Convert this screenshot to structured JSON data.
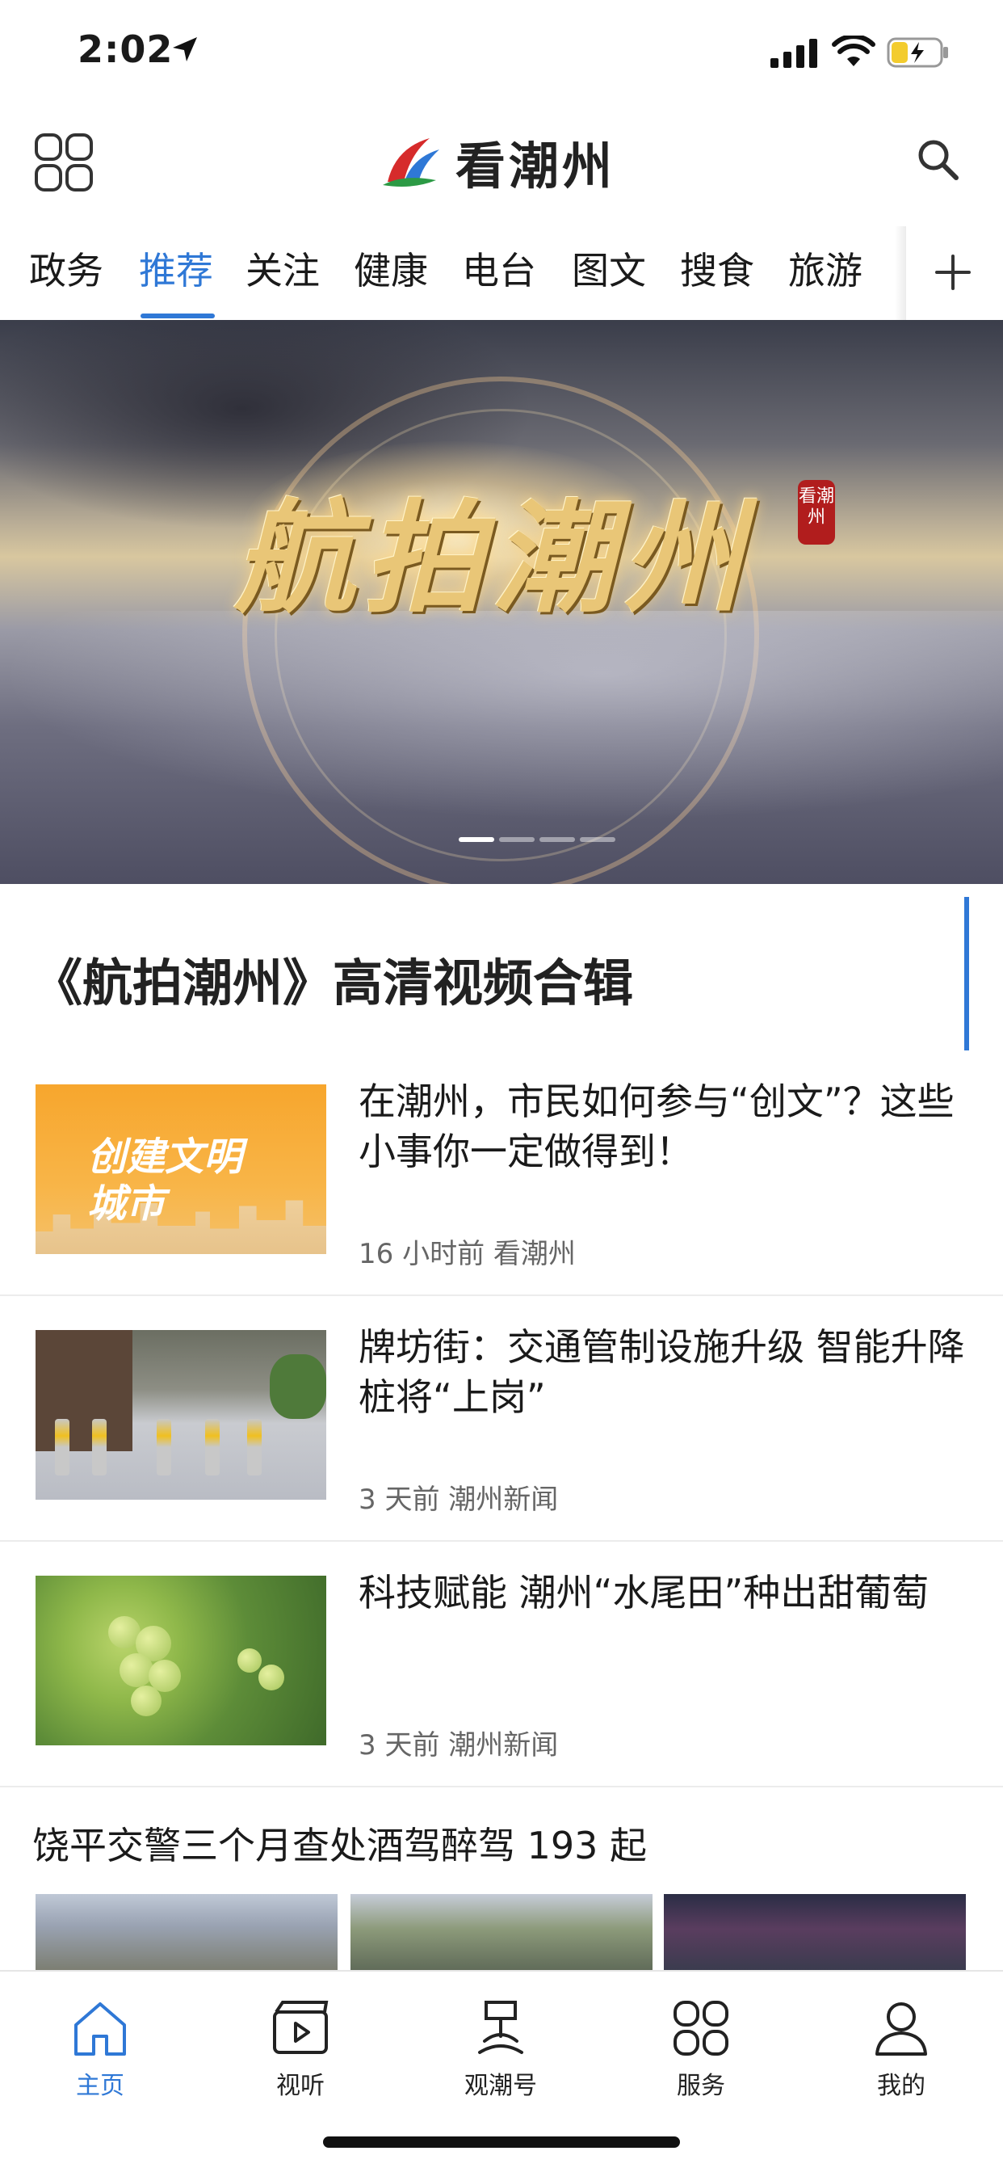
{
  "status": {
    "time": "2:02"
  },
  "header": {
    "app_name": "看潮州"
  },
  "tabs": [
    {
      "label": "政务"
    },
    {
      "label": "推荐"
    },
    {
      "label": "关注"
    },
    {
      "label": "健康"
    },
    {
      "label": "电台"
    },
    {
      "label": "图文"
    },
    {
      "label": "搜食"
    },
    {
      "label": "旅游"
    }
  ],
  "active_tab": "推荐",
  "banner": {
    "title": "航拍潮州",
    "seal": "看潮州",
    "slide_index": 1,
    "slide_count": 4
  },
  "section": {
    "title": "《航拍潮州》高清视频合辑"
  },
  "news": [
    {
      "title": "在潮州，市民如何参与“创文”？这些小事你一定做得到！",
      "time": "16 小时前",
      "source": "看潮州",
      "thumb_text_1": "创建文明",
      "thumb_text_2": "城市"
    },
    {
      "title": "牌坊街：交通管制设施升级 智能升降桩将“上岗”",
      "time": "3 天前",
      "source": "潮州新闻"
    },
    {
      "title": "科技赋能 潮州“水尾田”种出甜葡萄",
      "time": "3 天前",
      "source": "潮州新闻"
    }
  ],
  "feature": {
    "title": "饶平交警三个月查处酒驾醉驾 193 起"
  },
  "bottom_nav": [
    {
      "label": "主页",
      "icon": "home-icon"
    },
    {
      "label": "视听",
      "icon": "video-icon"
    },
    {
      "label": "观潮号",
      "icon": "account-icon"
    },
    {
      "label": "服务",
      "icon": "services-icon"
    },
    {
      "label": "我的",
      "icon": "profile-icon"
    }
  ],
  "colors": {
    "accent": "#2f78d6",
    "text": "#1a1a1a",
    "meta": "#666666"
  }
}
